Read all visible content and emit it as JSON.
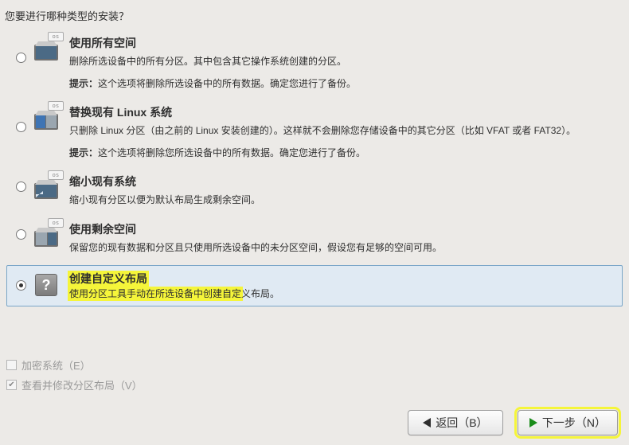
{
  "prompt": "您要进行哪种类型的安装？",
  "options": [
    {
      "title": "使用所有空间",
      "desc": "删除所选设备中的所有分区。其中包含其它操作系统创建的分区。",
      "hint_prefix": "提示：",
      "hint": "这个选项将删除所选设备中的所有数据。确定您进行了备份。"
    },
    {
      "title": "替换现有 Linux 系统",
      "desc": "只删除 Linux 分区（由之前的 Linux 安装创建的）。这样就不会删除您存储设备中的其它分区（比如 VFAT 或者 FAT32）。",
      "hint_prefix": "提示：",
      "hint": "这个选项将删除您所选设备中的所有数据。确定您进行了备份。"
    },
    {
      "title": "缩小现有系统",
      "desc": "缩小现有分区以便为默认布局生成剩余空间。"
    },
    {
      "title": "使用剩余空间",
      "desc": "保留您的现有数据和分区且只使用所选设备中的未分区空间，假设您有足够的空间可用。"
    },
    {
      "title": "创建自定义布局",
      "desc_hl": "使用分区工具手动在所选设备中创建自定",
      "desc_tail": "义布局。"
    }
  ],
  "checks": {
    "encrypt": "加密系统（E）",
    "review": "查看并修改分区布局（V）"
  },
  "buttons": {
    "back": "返回（B）",
    "next": "下一步（N）"
  },
  "icon_badge": "os"
}
